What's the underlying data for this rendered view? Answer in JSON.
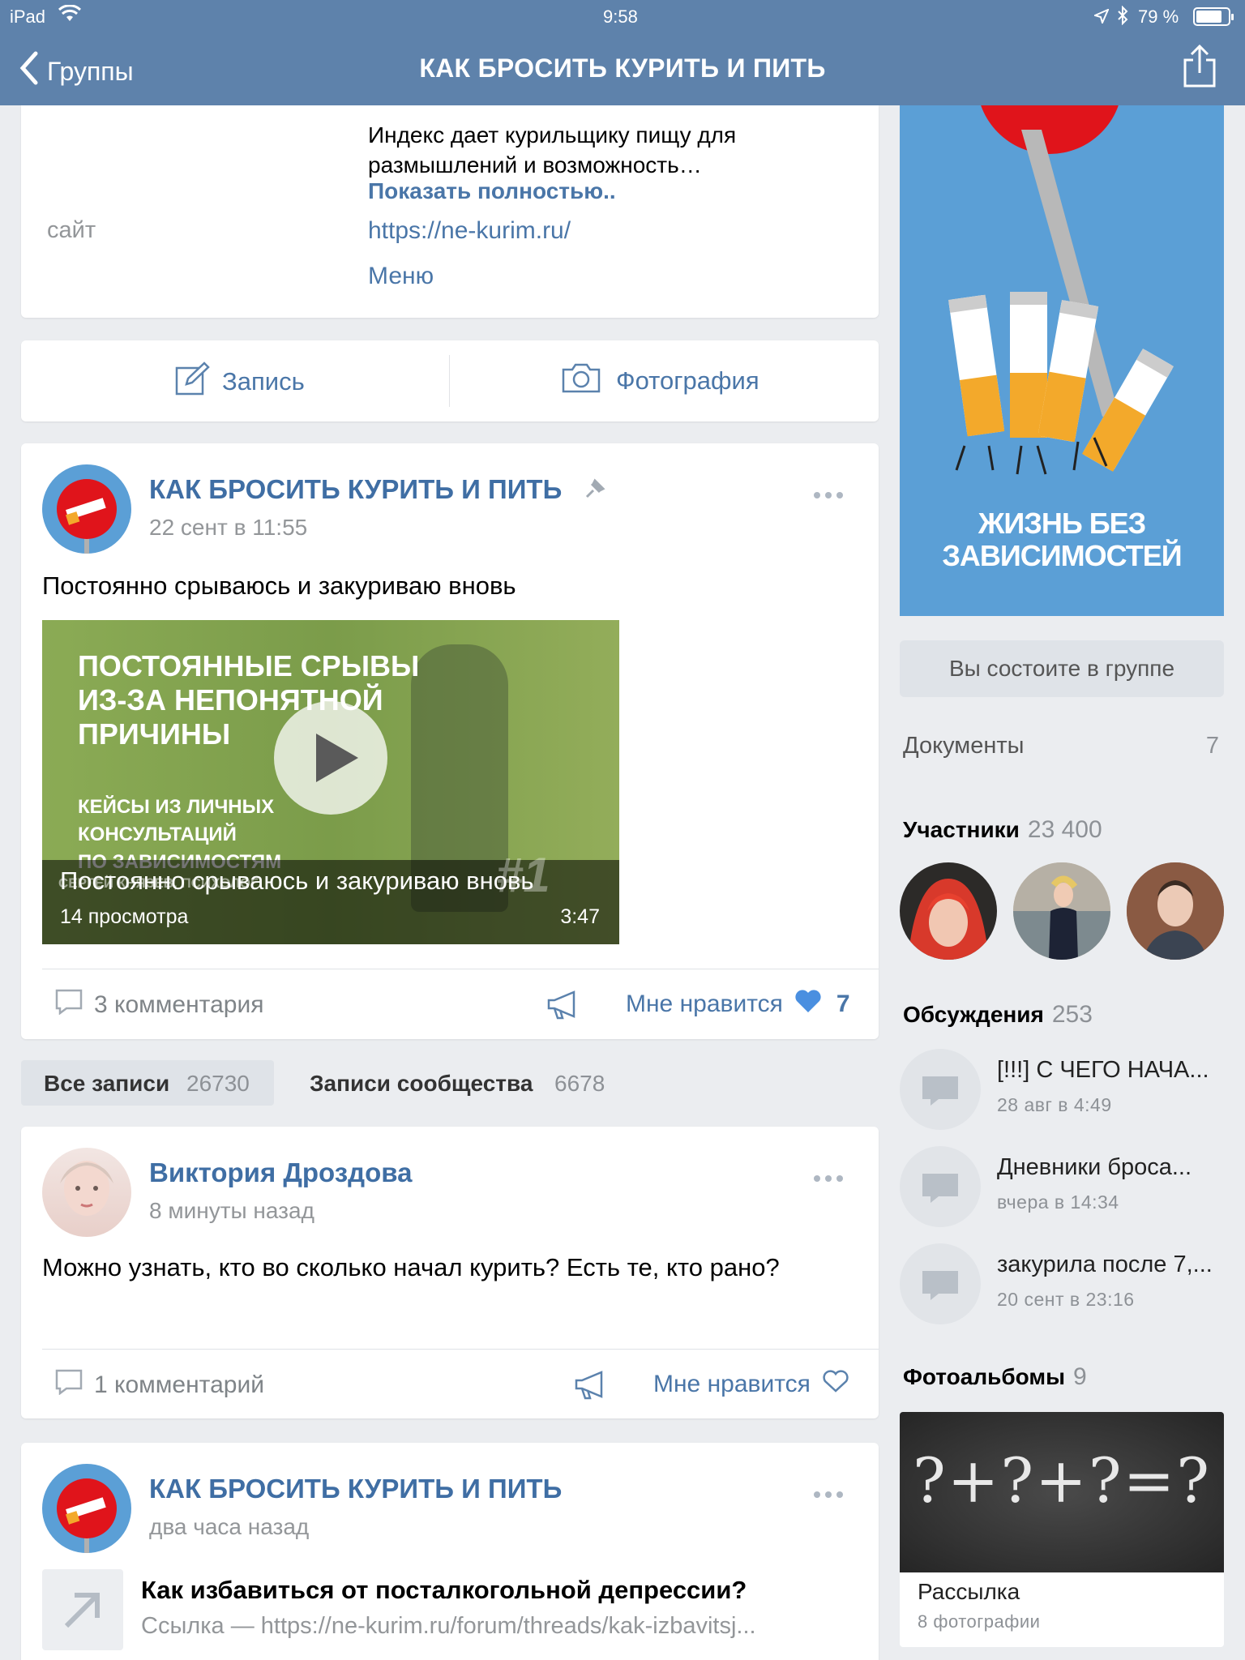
{
  "status_bar": {
    "device": "iPad",
    "time": "9:58",
    "battery": "79 %"
  },
  "nav": {
    "back_label": "Группы",
    "title": "КАК БРОСИТЬ КУРИТЬ И ПИТЬ"
  },
  "info": {
    "description": "Индекс дает курильщику пищу для размышлений и возможность…",
    "show_more": "Показать полностью..",
    "site_label": "сайт",
    "site_url": "https://ne-kurim.ru/",
    "menu": "Меню"
  },
  "compose": {
    "post_label": "Запись",
    "photo_label": "Фотография"
  },
  "pinned_post": {
    "author": "КАК БРОСИТЬ КУРИТЬ И ПИТЬ",
    "date": "22 сент в 11:55",
    "text": "Постоянно срываюсь и закуриваю вновь",
    "video": {
      "overlay_line1": "ПОСТОЯННЫЕ СРЫВЫ",
      "overlay_line2": "ИЗ-ЗА НЕПОНЯТНОЙ",
      "overlay_line3": "ПРИЧИНЫ",
      "overlay_sub1": "КЕЙСЫ ИЗ ЛИЧНЫХ",
      "overlay_sub2": "КОНСУЛЬТАЦИЙ",
      "overlay_sub3": "ПО ЗАВИСИМОСТЯМ",
      "overlay_author": "СЕРГЕЙ КНЯЗЕВ, ПСИХОЛОГ",
      "overlay_num": "#1",
      "title": "Постоянно срываюсь и закуриваю вновь",
      "views": "14 просмотра",
      "duration": "3:47"
    },
    "comments": "3 комментария",
    "like_label": "Мне нравится",
    "likes": "7"
  },
  "filter": {
    "all_label": "Все записи",
    "all_count": "26730",
    "community_label": "Записи сообщества",
    "community_count": "6678"
  },
  "post2": {
    "author": "Виктория Дроздова",
    "time": "8 минуты назад",
    "text": "Можно узнать, кто во сколько начал курить? Есть те, кто рано?",
    "comments": "1 комментарий",
    "like_label": "Мне нравится"
  },
  "post3": {
    "author": "КАК БРОСИТЬ КУРИТЬ И ПИТЬ",
    "time": "два часа назад",
    "link_title": "Как избавиться от посталкогольной депрессии?",
    "link_url": "Ссылка — https://ne-kurim.ru/forum/threads/kak-izbavitsj..."
  },
  "cover": {
    "line1": "ЖИЗНЬ БЕЗ",
    "line2": "ЗАВИСИМОСТЕЙ"
  },
  "sidebar": {
    "member_button": "Вы состоите в группе",
    "documents_label": "Документы",
    "documents_count": "7",
    "members_label": "Участники",
    "members_count": "23 400",
    "discussions_label": "Обсуждения",
    "discussions_count": "253",
    "discussions": [
      {
        "title": "[!!!] С ЧЕГО НАЧА...",
        "date": "28 авг в 4:49"
      },
      {
        "title": "Дневники броса...",
        "date": "вчера в 14:34"
      },
      {
        "title": "закурила после 7,...",
        "date": "20 сент в 23:16"
      }
    ],
    "albums_label": "Фотоальбомы",
    "albums_count": "9",
    "album": {
      "title": "Рассылка",
      "count": "8 фотографии",
      "chalk": "?+?+?=?"
    }
  },
  "colors": {
    "header": "#5e82ab",
    "link": "#4a76a8",
    "background": "#ebedf0",
    "cover": "#5b9fd6",
    "like_heart": "#4a8fe0"
  }
}
